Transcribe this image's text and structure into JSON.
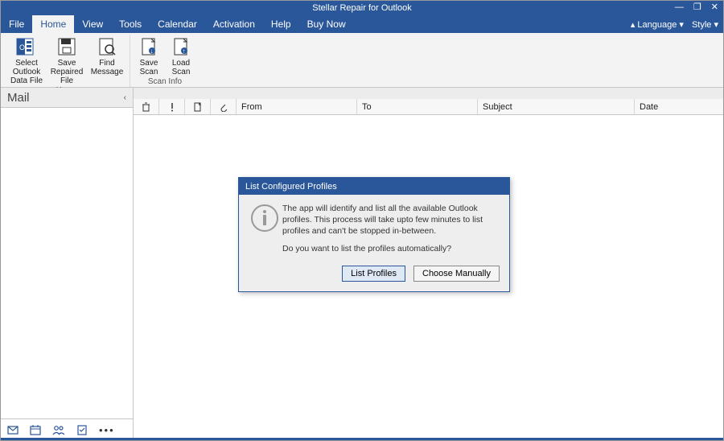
{
  "app": {
    "title": "Stellar Repair for Outlook"
  },
  "window_controls": {
    "min": "—",
    "max": "❐",
    "close": "✕"
  },
  "menubar": {
    "items": [
      "File",
      "Home",
      "View",
      "Tools",
      "Calendar",
      "Activation",
      "Help",
      "Buy Now"
    ],
    "active_index": 1,
    "right": {
      "language": "Language",
      "style": "Style"
    }
  },
  "ribbon": {
    "groups": [
      {
        "label": "Home",
        "buttons": [
          {
            "name": "select-outlook-data-file-button",
            "label": "Select Outlook\nData File"
          },
          {
            "name": "save-repaired-file-button",
            "label": "Save\nRepaired File"
          },
          {
            "name": "find-message-button",
            "label": "Find\nMessage"
          }
        ]
      },
      {
        "label": "Scan Info",
        "buttons": [
          {
            "name": "save-scan-button",
            "label": "Save\nScan"
          },
          {
            "name": "load-scan-button",
            "label": "Load\nScan"
          }
        ]
      }
    ]
  },
  "nav": {
    "title": "Mail"
  },
  "columns": [
    "From",
    "To",
    "Subject",
    "Date"
  ],
  "navfooter_icons": [
    "mail-icon",
    "calendar-icon",
    "people-icon",
    "tasks-icon",
    "more-icon"
  ],
  "dialog": {
    "title": "List Configured Profiles",
    "line1": "The app will identify and list all the available Outlook profiles. This process will take upto few minutes to list profiles and can't be stopped in-between.",
    "line2": "Do you want to list the profiles automatically?",
    "btn_primary": "List Profiles",
    "btn_secondary": "Choose Manually"
  }
}
